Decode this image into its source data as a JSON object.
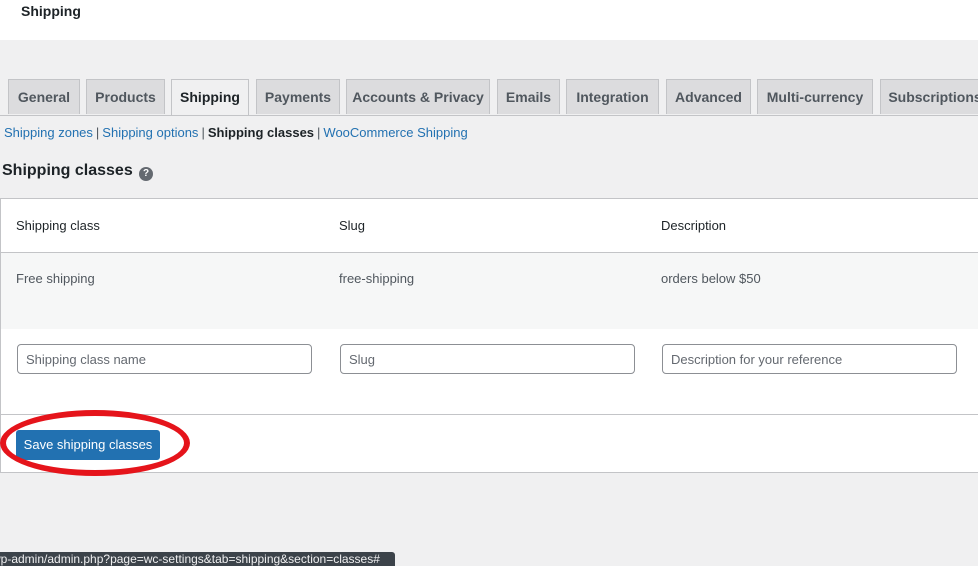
{
  "header": {
    "title": "Shipping"
  },
  "tabs": [
    {
      "label": "General"
    },
    {
      "label": "Products"
    },
    {
      "label": "Shipping",
      "active": true
    },
    {
      "label": "Payments"
    },
    {
      "label": "Accounts & Privacy"
    },
    {
      "label": "Emails"
    },
    {
      "label": "Integration"
    },
    {
      "label": "Advanced"
    },
    {
      "label": "Multi-currency"
    },
    {
      "label": "Subscriptions"
    }
  ],
  "subnav": {
    "items": [
      {
        "label": "Shipping zones"
      },
      {
        "label": "Shipping options"
      },
      {
        "label": "Shipping classes",
        "current": true
      },
      {
        "label": "WooCommerce Shipping"
      }
    ],
    "separator": "|"
  },
  "section": {
    "title": "Shipping classes",
    "help_icon": "question-circle-icon"
  },
  "table": {
    "columns": [
      "Shipping class",
      "Slug",
      "Description"
    ],
    "rows": [
      {
        "name": "Free shipping",
        "slug": "free-shipping",
        "description": "orders below $50"
      }
    ],
    "new_row": {
      "name_placeholder": "Shipping class name",
      "slug_placeholder": "Slug",
      "description_placeholder": "Description for your reference"
    },
    "save_label": "Save shipping classes"
  },
  "status_bar": {
    "url": "wp-admin/admin.php?page=wc-settings&tab=shipping&section=classes#"
  },
  "colors": {
    "accent": "#2271b1",
    "highlight": "#e5141b",
    "background": "#f0f0f1"
  }
}
